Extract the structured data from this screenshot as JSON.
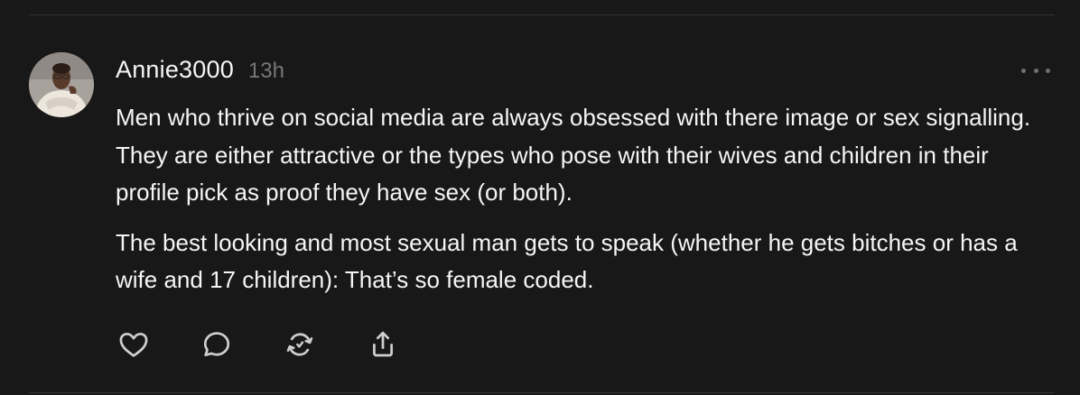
{
  "post": {
    "author": {
      "username": "Annie3000",
      "avatar": "profile-photo"
    },
    "timestamp": "13h",
    "more_icon": "ellipsis-icon",
    "paragraphs": [
      "Men who thrive on social media are always obsessed with there image or sex signalling. They are either attractive or the types who pose with their wives and children in their profile pick as proof they have sex (or both).",
      "The best looking and most sexual man gets to speak (whether he gets bitches or has a wife and 17 children): That’s so female coded."
    ],
    "actions": [
      {
        "name": "like",
        "icon": "heart-icon"
      },
      {
        "name": "reply",
        "icon": "comment-icon"
      },
      {
        "name": "repost",
        "icon": "repost-icon"
      },
      {
        "name": "share",
        "icon": "share-icon"
      }
    ]
  },
  "colors": {
    "background": "#181818",
    "text": "#f3f5f7",
    "muted": "#777777",
    "divider": "#323232",
    "icon": "#cfcfcf"
  }
}
